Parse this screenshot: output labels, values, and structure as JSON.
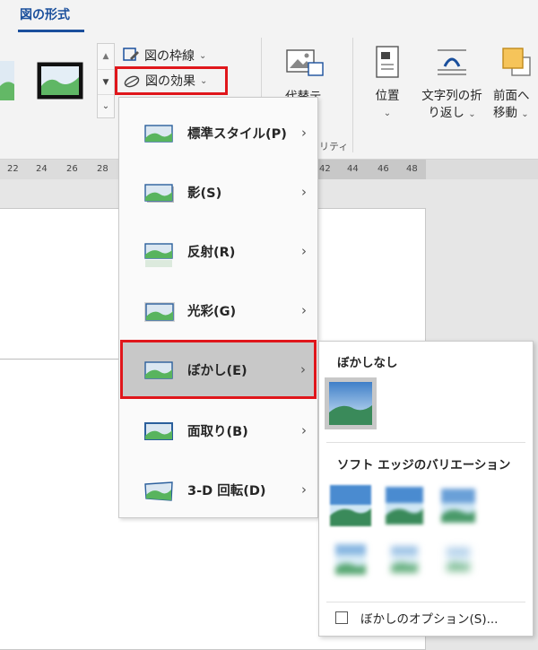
{
  "ribbon": {
    "tab_title": "図の形式",
    "picture_border_label": "図の枠線",
    "picture_effects_label": "図の効果",
    "alt_text_label": "代替テ",
    "accessibility_label": "リティ",
    "position_label": "位置",
    "wrap_text_line1": "文字列の折",
    "wrap_text_line2": "り返し",
    "bring_forward_line1": "前面へ",
    "bring_forward_line2": "移動"
  },
  "ruler": {
    "numbers": [
      "22",
      "24",
      "26",
      "28",
      "42",
      "44",
      "46",
      "48"
    ]
  },
  "effects_menu": {
    "items": [
      {
        "label": "標準スタイル(P)"
      },
      {
        "label": "影(S)"
      },
      {
        "label": "反射(R)"
      },
      {
        "label": "光彩(G)"
      },
      {
        "label": "ぼかし(E)"
      },
      {
        "label": "面取り(B)"
      },
      {
        "label": "3-D 回転(D)"
      }
    ],
    "active_index": 4
  },
  "blur_submenu": {
    "no_blur_heading": "ぼかしなし",
    "variations_heading": "ソフト エッジのバリエーション",
    "options_label": "ぼかしのオプション(S)..."
  },
  "colors": {
    "accent": "#1a4f9c",
    "highlight_red": "#e0161b",
    "menu_active": "#c8c8c8"
  }
}
